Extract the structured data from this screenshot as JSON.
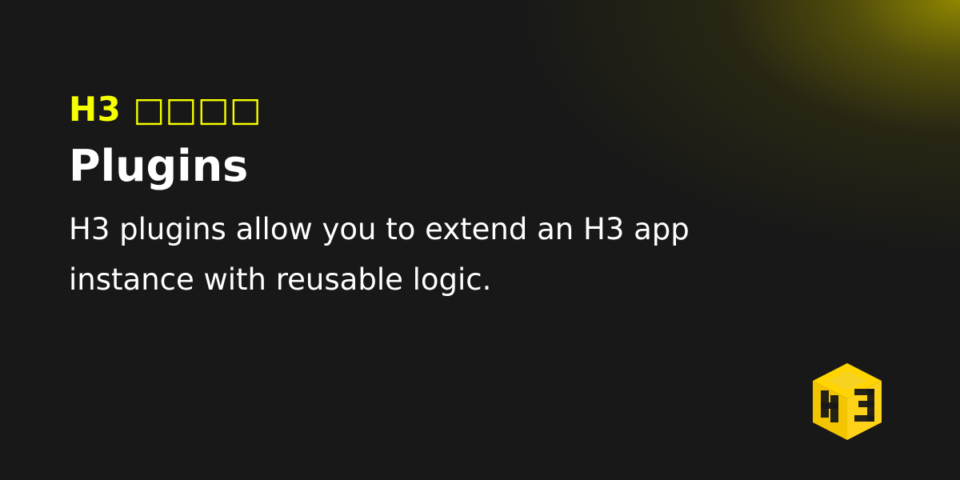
{
  "eyebrow": "H3 □□□□",
  "title": "Plugins",
  "description": "H3 plugins allow you to extend an H3 app instance with reusable logic.",
  "colors": {
    "background": "#181818",
    "accent": "#f6ff00",
    "text": "#ffffff",
    "logo_top": "#ffd400",
    "logo_left": "#f3c400",
    "logo_right": "#ffd21a"
  },
  "icons": {
    "logo": "h3-cube-logo-icon"
  }
}
